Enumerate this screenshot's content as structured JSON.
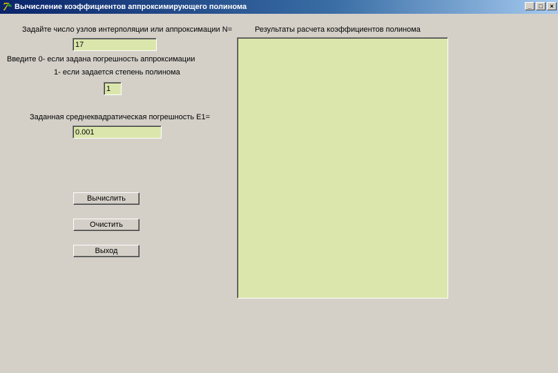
{
  "window": {
    "title": "Вычисление коэффициентов аппроксимирующего полинома",
    "minimize_glyph": "_",
    "maximize_glyph": "□",
    "close_glyph": "×"
  },
  "form": {
    "nodes_label": "Задайте число узлов интерполяции или аппроксимации N=",
    "nodes_value": "17",
    "mode_label_line1": "Введите 0- если задана погрешность аппроксимации",
    "mode_label_line2": "1- если задается степень полинома",
    "mode_value": "1",
    "error_label": "Заданная среднеквадратическая погрешность E1=",
    "error_value": "0.001"
  },
  "buttons": {
    "compute": "Вычислить",
    "clear": "Очистить",
    "exit": "Выход"
  },
  "results": {
    "label": "Результаты расчета коэффициентов полинома",
    "text": ""
  },
  "colors": {
    "window_bg": "#d4d0c8",
    "field_bg": "#dbe6ac",
    "titlebar_start": "#0a246a",
    "titlebar_end": "#a6caf0"
  }
}
